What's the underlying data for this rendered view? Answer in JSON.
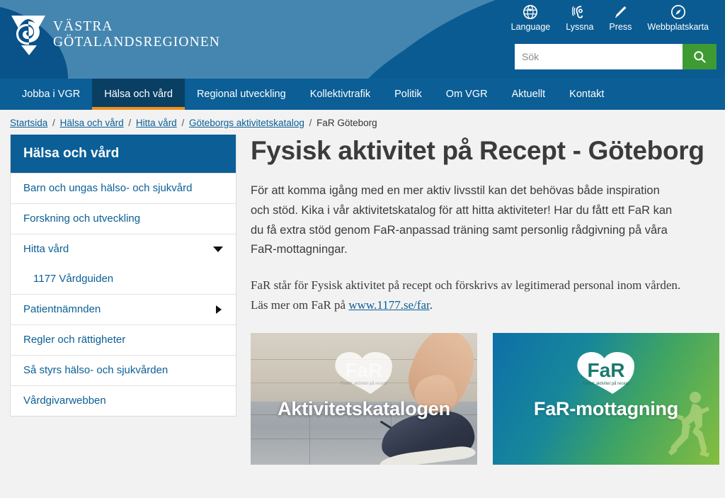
{
  "site": {
    "logo_line1": "VÄSTRA",
    "logo_line2": "GÖTALANDSREGIONEN",
    "brand_blue": "#065E96",
    "accent_orange": "#F0901E",
    "search_green": "#3E9B33"
  },
  "utility_nav": [
    {
      "label": "Language",
      "icon": "globe-icon"
    },
    {
      "label": "Lyssna",
      "icon": "listen-ear-icon"
    },
    {
      "label": "Press",
      "icon": "pencil-icon"
    },
    {
      "label": "Webbplatskarta",
      "icon": "compass-icon"
    }
  ],
  "search": {
    "placeholder": "Sök",
    "value": "",
    "button_icon": "search-icon"
  },
  "main_nav": [
    {
      "label": "Jobba i VGR",
      "active": false
    },
    {
      "label": "Hälsa och vård",
      "active": true
    },
    {
      "label": "Regional utveckling",
      "active": false
    },
    {
      "label": "Kollektivtrafik",
      "active": false
    },
    {
      "label": "Politik",
      "active": false
    },
    {
      "label": "Om VGR",
      "active": false
    },
    {
      "label": "Aktuellt",
      "active": false
    },
    {
      "label": "Kontakt",
      "active": false
    }
  ],
  "breadcrumb": {
    "links": [
      "Startsida",
      "Hälsa och vård",
      "Hitta vård",
      "Göteborgs aktivitetskatalog"
    ],
    "current": "FaR Göteborg",
    "separator": "/"
  },
  "sidebar": {
    "header": "Hälsa och vård",
    "items": [
      {
        "label": "Barn och ungas hälso- och sjukvård",
        "indicator": "none",
        "sub": false
      },
      {
        "label": "Forskning och utveckling",
        "indicator": "none",
        "sub": false
      },
      {
        "label": "Hitta vård",
        "indicator": "caret-down",
        "sub": false
      },
      {
        "label": "1177 Vårdguiden",
        "indicator": "none",
        "sub": true
      },
      {
        "label": "Patientnämnden",
        "indicator": "caret-right",
        "sub": false
      },
      {
        "label": "Regler och rättigheter",
        "indicator": "none",
        "sub": false
      },
      {
        "label": "Så styrs hälso- och sjukvården",
        "indicator": "none",
        "sub": false
      },
      {
        "label": "Vårdgivarwebben",
        "indicator": "none",
        "sub": false
      }
    ]
  },
  "main": {
    "title": "Fysisk aktivitet på Recept - Göteborg",
    "lead_paragraph": "För att komma igång med en mer aktiv livsstil kan det behövas både inspiration och stöd. Kika i vår aktivitetskatalog för att hitta aktiviteter! Har du fått ett FaR kan du få extra stöd genom FaR-anpassad träning samt personlig rådgivning på våra FaR-mottagningar.",
    "second_paragraph_before": "FaR står för Fysisk aktivitet på recept och förskrivs av legitimerad personal inom vården. Läs mer om FaR på ",
    "second_paragraph_link": "www.1177.se/far",
    "second_paragraph_after": ".",
    "cards": [
      {
        "caption": "Aktivitetskatalogen",
        "logo_text": "FaR",
        "logo_tagline": "Fysisk aktivitet på recept",
        "style": "photo"
      },
      {
        "caption": "FaR-mottagning",
        "logo_text": "FaR",
        "logo_tagline": "Fysisk aktivitet på recept",
        "style": "gradient"
      }
    ]
  }
}
